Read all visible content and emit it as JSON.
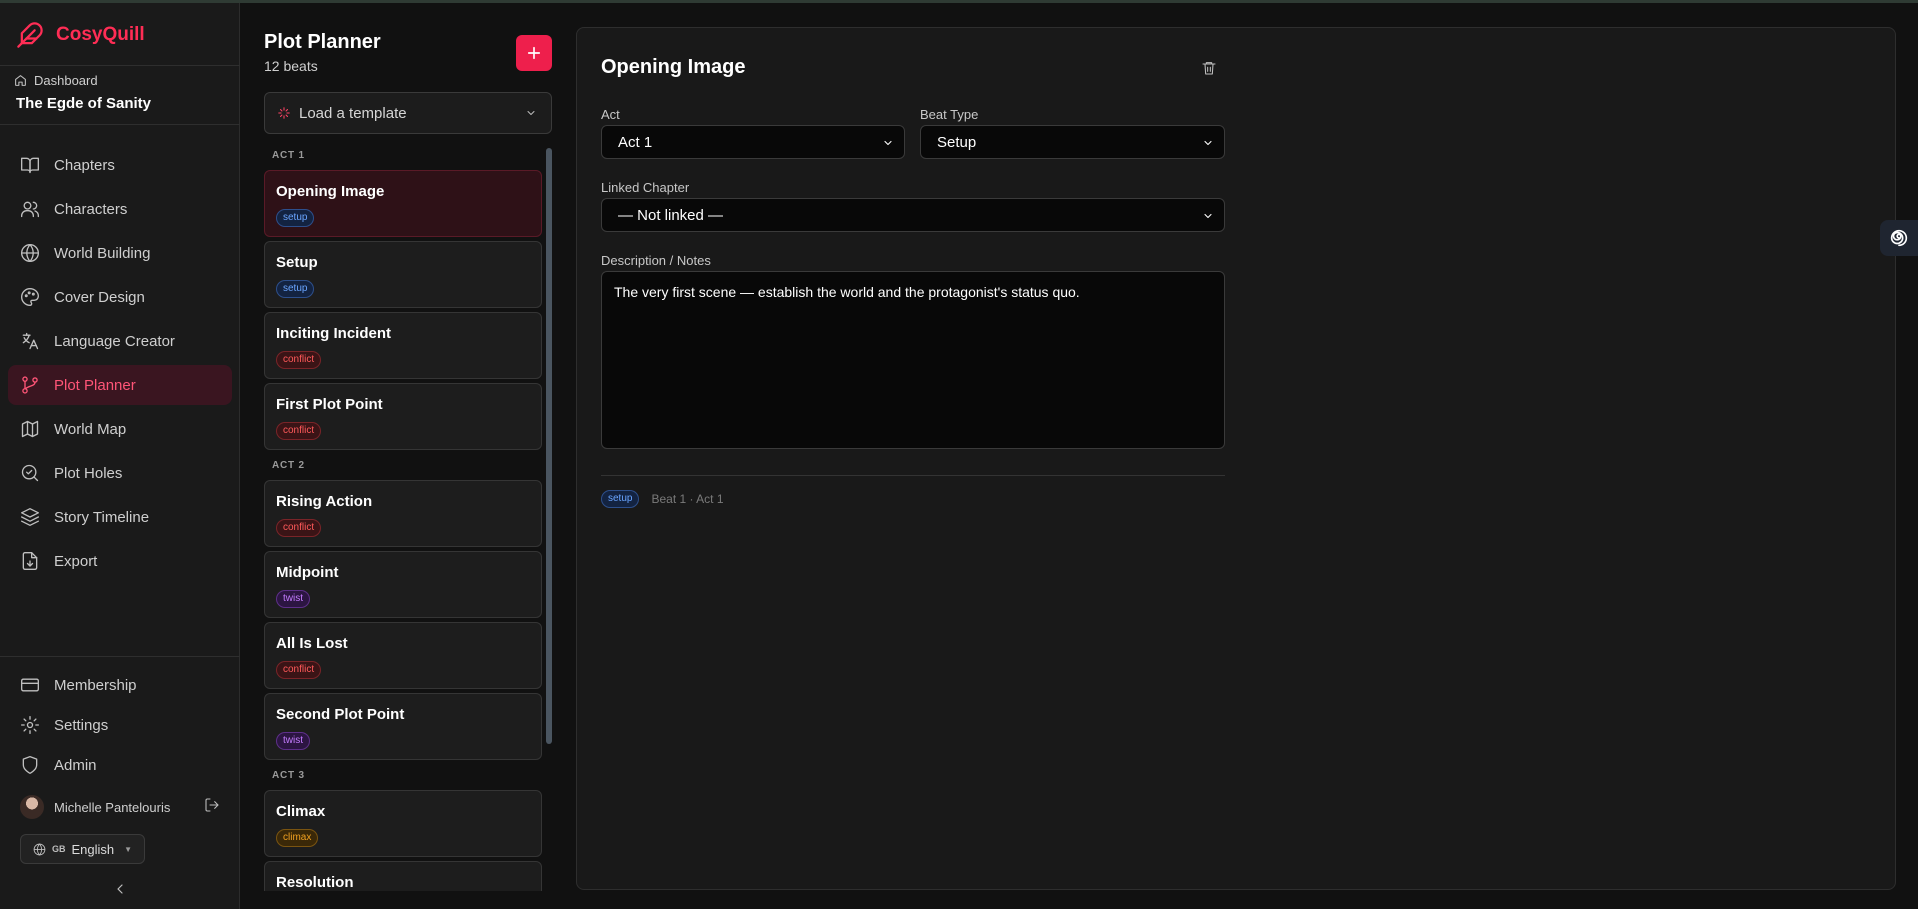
{
  "brand": {
    "name": "CosyQuill"
  },
  "breadcrumb": {
    "label": "Dashboard",
    "project": "The Egde of Sanity"
  },
  "sidebar": {
    "items": [
      {
        "label": "Chapters",
        "icon": "book-open-icon"
      },
      {
        "label": "Characters",
        "icon": "users-icon"
      },
      {
        "label": "World Building",
        "icon": "globe-icon"
      },
      {
        "label": "Cover Design",
        "icon": "palette-icon"
      },
      {
        "label": "Language Creator",
        "icon": "translate-icon"
      },
      {
        "label": "Plot Planner",
        "icon": "git-branch-icon",
        "active": true
      },
      {
        "label": "World Map",
        "icon": "map-icon"
      },
      {
        "label": "Plot Holes",
        "icon": "search-check-icon"
      },
      {
        "label": "Story Timeline",
        "icon": "layers-icon"
      },
      {
        "label": "Export",
        "icon": "file-export-icon"
      }
    ],
    "bottom": [
      {
        "label": "Membership",
        "icon": "credit-card-icon"
      },
      {
        "label": "Settings",
        "icon": "gear-icon"
      },
      {
        "label": "Admin",
        "icon": "shield-icon"
      }
    ],
    "user": {
      "name": "Michelle Pantelouris"
    },
    "language": {
      "flag": "GB",
      "label": "English"
    }
  },
  "planner": {
    "title": "Plot Planner",
    "count": "12 beats",
    "template_placeholder": "Load a template",
    "acts": [
      {
        "label": "ACT 1",
        "beats": [
          {
            "name": "Opening Image",
            "tag": "setup",
            "selected": true
          },
          {
            "name": "Setup",
            "tag": "setup"
          },
          {
            "name": "Inciting Incident",
            "tag": "conflict"
          },
          {
            "name": "First Plot Point",
            "tag": "conflict"
          }
        ]
      },
      {
        "label": "ACT 2",
        "beats": [
          {
            "name": "Rising Action",
            "tag": "conflict"
          },
          {
            "name": "Midpoint",
            "tag": "twist"
          },
          {
            "name": "All Is Lost",
            "tag": "conflict"
          },
          {
            "name": "Second Plot Point",
            "tag": "twist"
          }
        ]
      },
      {
        "label": "ACT 3",
        "beats": [
          {
            "name": "Climax",
            "tag": "climax"
          },
          {
            "name": "Resolution",
            "tag": ""
          }
        ]
      }
    ]
  },
  "detail": {
    "title": "Opening Image",
    "act_label": "Act",
    "act_value": "Act 1",
    "beat_type_label": "Beat Type",
    "beat_type_value": "Setup",
    "linked_chapter_label": "Linked Chapter",
    "linked_chapter_value": "— Not linked —",
    "description_label": "Description / Notes",
    "description": "The very first scene — establish the world and the protagonist's status quo.",
    "meta_tag": "setup",
    "meta_text": "Beat 1 · Act 1"
  },
  "colors": {
    "accent": "#ee1f4c",
    "brand": "#ff2d55",
    "background": "#111111"
  }
}
